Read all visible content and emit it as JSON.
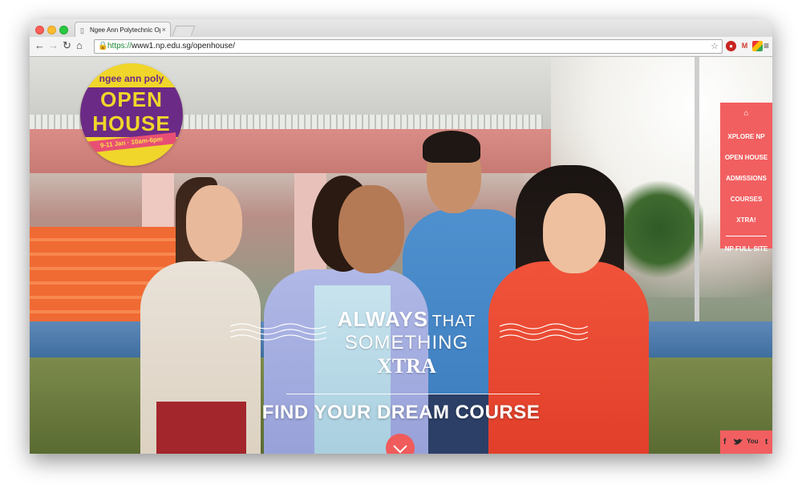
{
  "browser": {
    "tab_title": "Ngee Ann Polytechnic Oper",
    "tab_close": "×",
    "url_scheme": "https://",
    "url_rest": "www1.np.edu.sg/openhouse/",
    "back": "←",
    "forward": "→",
    "reload": "↻",
    "home": "⌂",
    "star": "☆",
    "menu": "≡",
    "ext_gmail": "M"
  },
  "badge": {
    "top_text": "ngee ann poly",
    "line1": "OPEN",
    "line2": "HOUSE",
    "date": "9-11 Jan · 10am-6pm"
  },
  "hero": {
    "always": "ALWAYS",
    "that": "THAT",
    "something": "SOMETHING",
    "xtra": "XTRA",
    "cta": "FIND YOUR DREAM COURSE"
  },
  "sidebar": {
    "home": "⌂",
    "items": [
      "XPLORE NP",
      "OPEN HOUSE",
      "ADMISSIONS",
      "COURSES",
      "XTRA!"
    ],
    "full_site": "NP FULL SITE"
  },
  "social": {
    "facebook": "f",
    "youtube": "You",
    "tumblr": "t"
  },
  "colors": {
    "accent": "#f25f60",
    "badge_yellow": "#f0d62a",
    "badge_purple": "#6b2a86"
  }
}
